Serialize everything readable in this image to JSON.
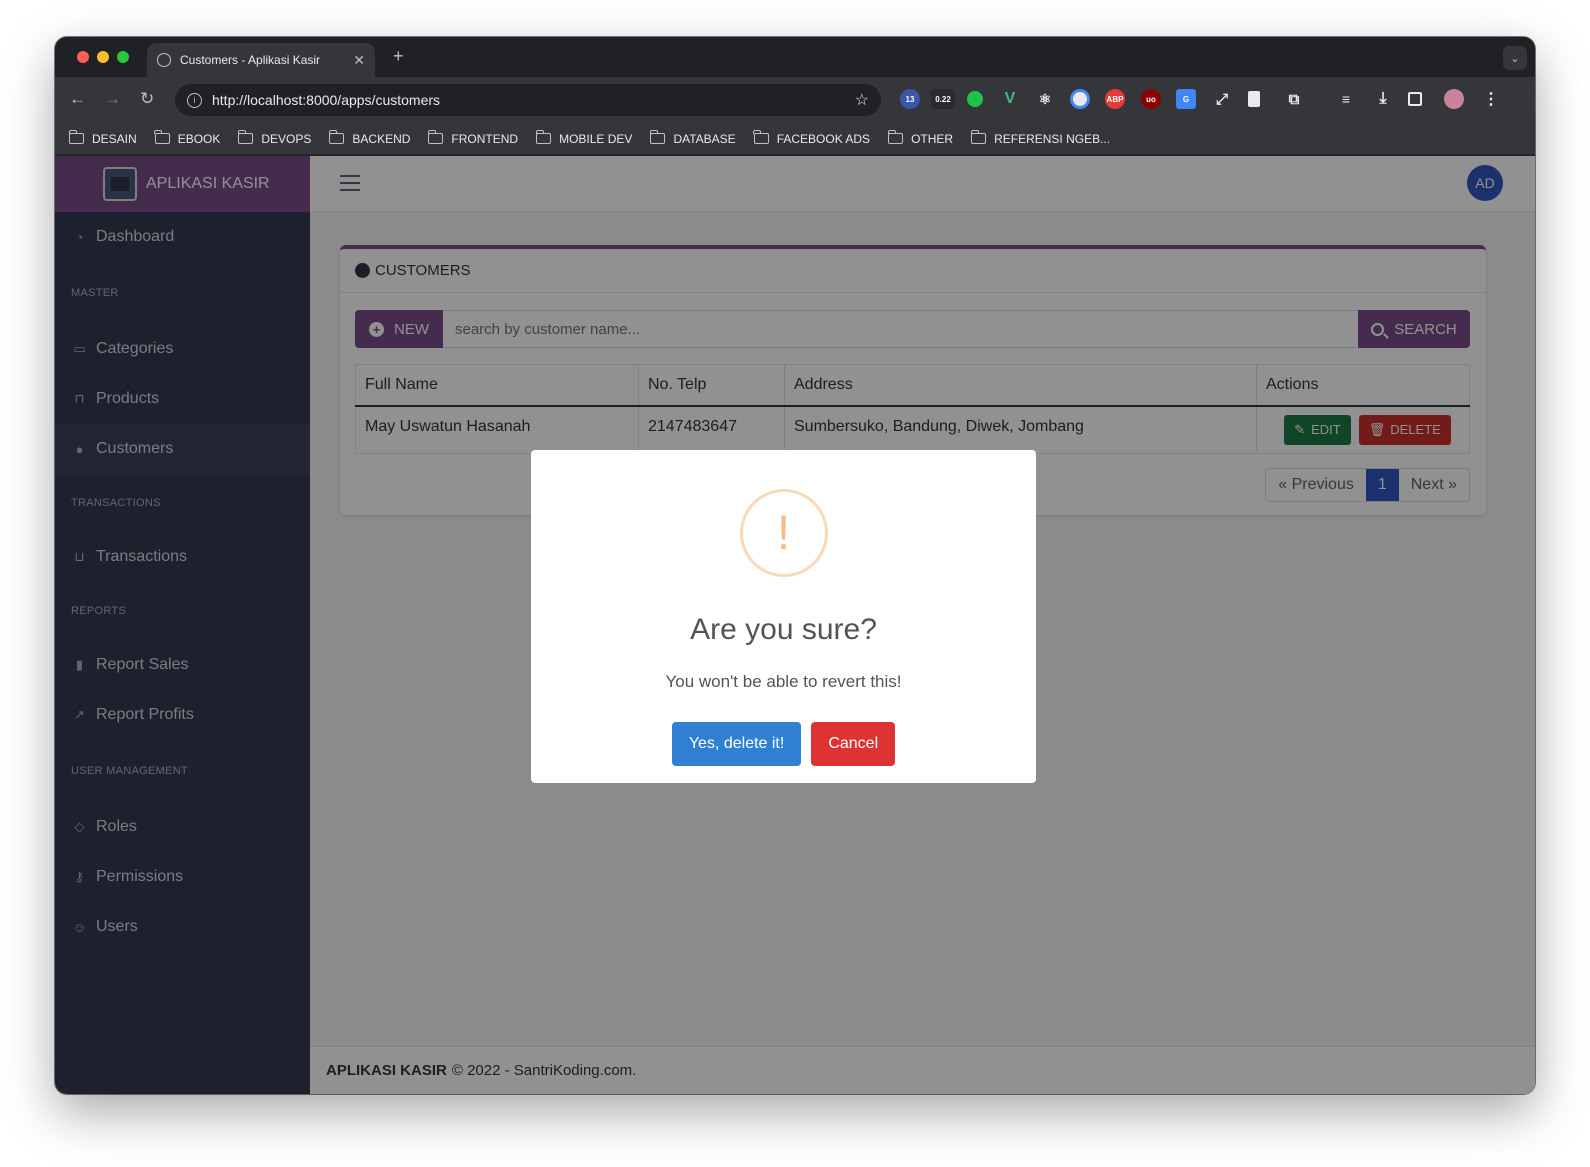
{
  "browser": {
    "tab_title": "Customers - Aplikasi Kasir",
    "url": "http://localhost:8000/apps/customers",
    "ext_badges": [
      "13",
      "0.22",
      "ABP",
      "uo"
    ],
    "bookmarks": [
      "DESAIN",
      "EBOOK",
      "DEVOPS",
      "BACKEND",
      "FRONTEND",
      "MOBILE DEV",
      "DATABASE",
      "FACEBOOK ADS",
      "OTHER",
      "REFERENSI NGEB..."
    ]
  },
  "sidebar": {
    "brand": "APLIKASI KASIR",
    "dashboard": "Dashboard",
    "sections": {
      "master": "MASTER",
      "transactions": "TRANSACTIONS",
      "reports": "REPORTS",
      "user_management": "USER MANAGEMENT"
    },
    "items": {
      "categories": "Categories",
      "products": "Products",
      "customers": "Customers",
      "transactions": "Transactions",
      "report_sales": "Report Sales",
      "report_profits": "Report Profits",
      "roles": "Roles",
      "permissions": "Permissions",
      "users": "Users"
    }
  },
  "header": {
    "avatar": "AD"
  },
  "card": {
    "title": "CUSTOMERS",
    "new_label": "NEW",
    "search_placeholder": "search by customer name...",
    "search_label": "SEARCH",
    "columns": [
      "Full Name",
      "No. Telp",
      "Address",
      "Actions"
    ],
    "rows": [
      {
        "name": "May Uswatun Hasanah",
        "phone": "2147483647",
        "address": "Sumbersuko, Bandung, Diwek, Jombang"
      }
    ],
    "edit_label": "EDIT",
    "delete_label": "DELETE",
    "pager": {
      "prev": "« Previous",
      "current": "1",
      "next": "Next »"
    }
  },
  "footer": {
    "brand": "APLIKASI KASIR",
    "text": "© 2022 - SantriKoding.com."
  },
  "modal": {
    "icon": "!",
    "title": "Are you sure?",
    "text": "You won't be able to revert this!",
    "confirm": "Yes, delete it!",
    "cancel": "Cancel"
  },
  "colors": {
    "brand": "#7a4d8a",
    "confirm": "#2f80d1",
    "cancel": "#dd3333",
    "edit": "#1f7a45",
    "delete": "#c9302c"
  }
}
